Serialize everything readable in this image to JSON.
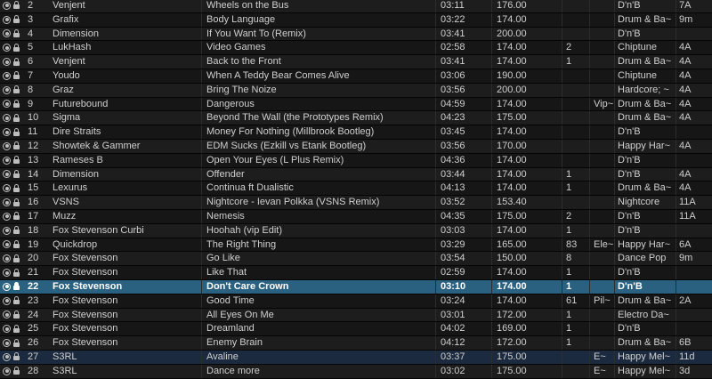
{
  "tracks": [
    {
      "num": "2",
      "artist": "Venjent",
      "title": "Wheels on the Bus",
      "time": "03:11",
      "bpm": "176.00",
      "rating": "",
      "g1": "",
      "g2": "D'n'B",
      "key": "7A",
      "selected": false,
      "marked": false
    },
    {
      "num": "3",
      "artist": "Grafix",
      "title": "Body Language",
      "time": "03:22",
      "bpm": "174.00",
      "rating": "",
      "g1": "",
      "g2": "Drum & Ba~",
      "key": "9m",
      "selected": false,
      "marked": false
    },
    {
      "num": "4",
      "artist": "Dimension",
      "title": "If You Want To (Remix)",
      "time": "03:41",
      "bpm": "200.00",
      "rating": "",
      "g1": "",
      "g2": "D'n'B",
      "key": "",
      "selected": false,
      "marked": false
    },
    {
      "num": "5",
      "artist": "LukHash",
      "title": "Video Games",
      "time": "02:58",
      "bpm": "174.00",
      "rating": "2",
      "g1": "",
      "g2": "Chiptune",
      "key": "4A",
      "selected": false,
      "marked": false
    },
    {
      "num": "6",
      "artist": "Venjent",
      "title": "Back to the Front",
      "time": "03:41",
      "bpm": "174.00",
      "rating": "1",
      "g1": "",
      "g2": "Drum & Ba~",
      "key": "4A",
      "selected": false,
      "marked": false
    },
    {
      "num": "7",
      "artist": "Youdo",
      "title": "When A Teddy Bear Comes Alive",
      "time": "03:06",
      "bpm": "190.00",
      "rating": "",
      "g1": "",
      "g2": "Chiptune",
      "key": "4A",
      "selected": false,
      "marked": false
    },
    {
      "num": "8",
      "artist": "Graz",
      "title": "Bring The Noize",
      "time": "03:56",
      "bpm": "200.00",
      "rating": "",
      "g1": "",
      "g2": "Hardcore; ~",
      "key": "4A",
      "selected": false,
      "marked": false
    },
    {
      "num": "9",
      "artist": "Futurebound",
      "title": "Dangerous",
      "time": "04:59",
      "bpm": "174.00",
      "rating": "",
      "g1": "Vip~",
      "g2": "Drum & Ba~",
      "key": "4A",
      "selected": false,
      "marked": false
    },
    {
      "num": "10",
      "artist": "Sigma",
      "title": "Beyond The Wall (the Prototypes Remix)",
      "time": "04:23",
      "bpm": "175.00",
      "rating": "",
      "g1": "",
      "g2": "Drum & Ba~",
      "key": "4A",
      "selected": false,
      "marked": false
    },
    {
      "num": "11",
      "artist": "Dire Straits",
      "title": "Money For Nothing (Millbrook Bootleg)",
      "time": "03:45",
      "bpm": "174.00",
      "rating": "",
      "g1": "",
      "g2": "D'n'B",
      "key": "",
      "selected": false,
      "marked": false
    },
    {
      "num": "12",
      "artist": "Showtek & Gammer",
      "title": "EDM Sucks (Ezkill vs Etank Bootleg)",
      "time": "03:56",
      "bpm": "170.00",
      "rating": "",
      "g1": "",
      "g2": "Happy Har~",
      "key": "4A",
      "selected": false,
      "marked": false
    },
    {
      "num": "13",
      "artist": "Rameses B",
      "title": "Open Your Eyes (L Plus Remix)",
      "time": "04:36",
      "bpm": "174.00",
      "rating": "",
      "g1": "",
      "g2": "D'n'B",
      "key": "",
      "selected": false,
      "marked": false
    },
    {
      "num": "14",
      "artist": "Dimension",
      "title": "Offender",
      "time": "03:44",
      "bpm": "174.00",
      "rating": "1",
      "g1": "",
      "g2": "D'n'B",
      "key": "4A",
      "selected": false,
      "marked": false
    },
    {
      "num": "15",
      "artist": "Lexurus",
      "title": "Continua ft Dualistic",
      "time": "04:13",
      "bpm": "174.00",
      "rating": "1",
      "g1": "",
      "g2": "Drum & Ba~",
      "key": "4A",
      "selected": false,
      "marked": false
    },
    {
      "num": "16",
      "artist": "VSNS",
      "title": "Nightcore - Ievan Polkka (VSNS Remix)",
      "time": "03:52",
      "bpm": "153.40",
      "rating": "",
      "g1": "",
      "g2": "Nightcore",
      "key": "11A",
      "selected": false,
      "marked": false
    },
    {
      "num": "17",
      "artist": "Muzz",
      "title": "Nemesis",
      "time": "04:35",
      "bpm": "175.00",
      "rating": "2",
      "g1": "",
      "g2": "D'n'B",
      "key": "11A",
      "selected": false,
      "marked": false
    },
    {
      "num": "18",
      "artist": "Fox Stevenson Curbi",
      "title": "Hoohah (vip Edit)",
      "time": "03:03",
      "bpm": "174.00",
      "rating": "1",
      "g1": "",
      "g2": "D'n'B",
      "key": "",
      "selected": false,
      "marked": false
    },
    {
      "num": "19",
      "artist": "Quickdrop",
      "title": "The Right Thing",
      "time": "03:29",
      "bpm": "165.00",
      "rating": "83",
      "g1": "Ele~",
      "g2": "Happy Har~",
      "key": "6A",
      "selected": false,
      "marked": false
    },
    {
      "num": "20",
      "artist": "Fox Stevenson",
      "title": "Go Like",
      "time": "03:54",
      "bpm": "150.00",
      "rating": "8",
      "g1": "",
      "g2": "Dance Pop",
      "key": "9m",
      "selected": false,
      "marked": false
    },
    {
      "num": "21",
      "artist": "Fox Stevenson",
      "title": "Like That",
      "time": "02:59",
      "bpm": "174.00",
      "rating": "1",
      "g1": "",
      "g2": "D'n'B",
      "key": "",
      "selected": false,
      "marked": false
    },
    {
      "num": "22",
      "artist": "Fox Stevenson",
      "title": "Don't Care Crown",
      "time": "03:10",
      "bpm": "174.00",
      "rating": "1",
      "g1": "",
      "g2": "D'n'B",
      "key": "",
      "selected": true,
      "marked": false
    },
    {
      "num": "23",
      "artist": "Fox Stevenson",
      "title": "Good Time",
      "time": "03:24",
      "bpm": "174.00",
      "rating": "61",
      "g1": "Pil~",
      "g2": "Drum & Ba~",
      "key": "2A",
      "selected": false,
      "marked": false
    },
    {
      "num": "24",
      "artist": "Fox Stevenson",
      "title": "All Eyes On Me",
      "time": "03:01",
      "bpm": "172.00",
      "rating": "1",
      "g1": "",
      "g2": "Electro Da~",
      "key": "",
      "selected": false,
      "marked": false
    },
    {
      "num": "25",
      "artist": "Fox Stevenson",
      "title": "Dreamland",
      "time": "04:02",
      "bpm": "169.00",
      "rating": "1",
      "g1": "",
      "g2": "D'n'B",
      "key": "",
      "selected": false,
      "marked": false
    },
    {
      "num": "26",
      "artist": "Fox Stevenson",
      "title": "Enemy Brain",
      "time": "04:12",
      "bpm": "172.00",
      "rating": "1",
      "g1": "",
      "g2": "Drum & Ba~",
      "key": "6B",
      "selected": false,
      "marked": false
    },
    {
      "num": "27",
      "artist": "S3RL",
      "title": "Avaline",
      "time": "03:37",
      "bpm": "175.00",
      "rating": "",
      "g1": "E~",
      "g2": "Happy Mel~",
      "key": "11d",
      "selected": false,
      "marked": true
    },
    {
      "num": "28",
      "artist": "S3RL",
      "title": "Dance more",
      "time": "03:02",
      "bpm": "175.00",
      "rating": "",
      "g1": "E~",
      "g2": "Happy Mel~",
      "key": "3d",
      "selected": false,
      "marked": false
    }
  ]
}
